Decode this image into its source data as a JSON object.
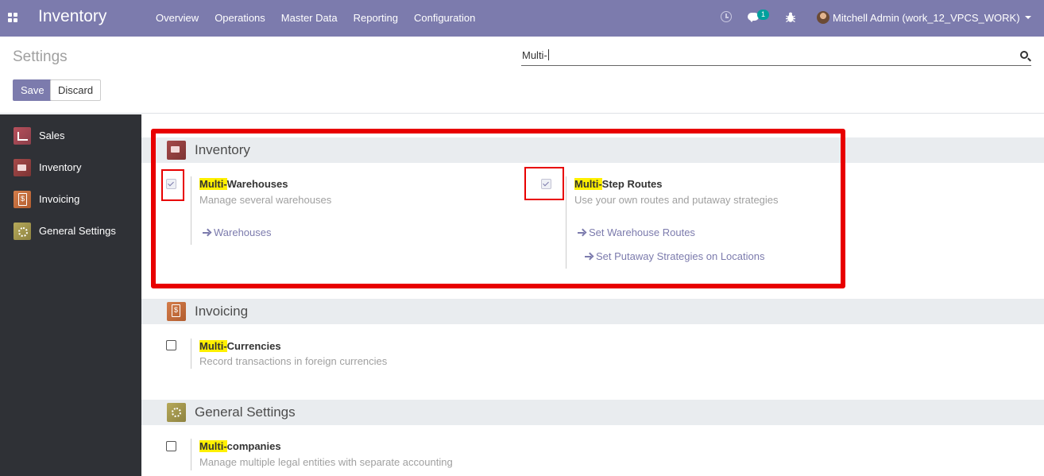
{
  "navbar": {
    "brand": "Inventory",
    "menu": [
      "Overview",
      "Operations",
      "Master Data",
      "Reporting",
      "Configuration"
    ],
    "message_count": "1",
    "user": "Mitchell Admin (work_12_VPCS_WORK)",
    "icons": [
      "apps-icon",
      "clock-icon",
      "chat-icon",
      "bug-icon"
    ]
  },
  "control_panel": {
    "title": "Settings",
    "save_label": "Save",
    "discard_label": "Discard",
    "search_value": "Multi-"
  },
  "sidebar": {
    "items": [
      {
        "label": "Sales",
        "icon": "sales-icon"
      },
      {
        "label": "Inventory",
        "icon": "inventory-icon"
      },
      {
        "label": "Invoicing",
        "icon": "invoicing-icon"
      },
      {
        "label": "General Settings",
        "icon": "gear-icon"
      }
    ]
  },
  "sections": {
    "inventory": {
      "title": "Inventory",
      "warehouses": {
        "highlight": "Multi-",
        "title_rest": "Warehouses",
        "description": "Manage several warehouses",
        "checked": true,
        "link": "Warehouses"
      },
      "routes": {
        "highlight": "Multi-",
        "title_rest": "Step Routes",
        "description": "Use your own routes and putaway strategies",
        "checked": true,
        "link1": "Set Warehouse Routes",
        "link2": "Set Putaway Strategies on Locations"
      }
    },
    "invoicing": {
      "title": "Invoicing",
      "currencies": {
        "highlight": "Multi-",
        "title_rest": "Currencies",
        "description": "Record transactions in foreign currencies",
        "checked": false
      }
    },
    "general": {
      "title": "General Settings",
      "companies": {
        "highlight": "Multi-",
        "title_rest": "companies",
        "description": "Manage multiple legal entities with separate accounting",
        "checked": false
      }
    }
  },
  "colors": {
    "brand": "#7c7bad",
    "sidebar": "#2f3136",
    "highlight": "#fff000",
    "annotation": "#e80000"
  }
}
